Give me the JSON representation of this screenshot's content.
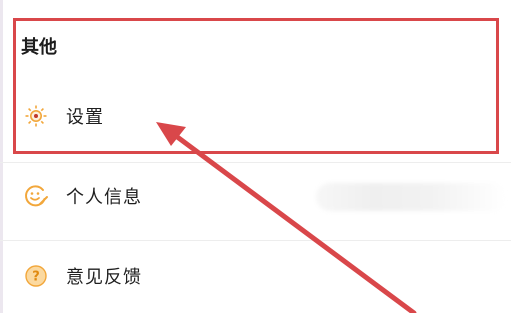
{
  "section": {
    "title": "其他"
  },
  "items": [
    {
      "label": "设置",
      "icon": "gear-icon"
    },
    {
      "label": "个人信息",
      "icon": "smiley-edit-icon"
    },
    {
      "label": "意见反馈",
      "icon": "question-icon"
    }
  ],
  "colors": {
    "highlight": "#d9474a",
    "icon_orange": "#f2a73b"
  }
}
